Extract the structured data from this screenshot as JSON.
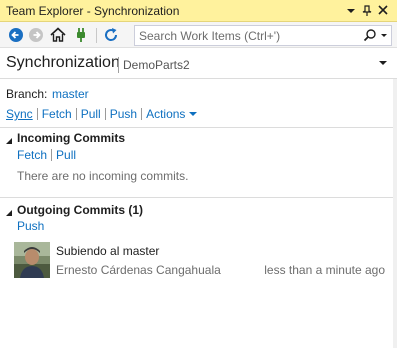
{
  "window": {
    "title": "Team Explorer - Synchronization",
    "title_bg": "#fff29d"
  },
  "toolbar": {
    "search_placeholder": "Search Work Items (Ctrl+')",
    "icons": [
      "back-icon",
      "forward-icon",
      "home-icon",
      "connect-icon",
      "refresh-icon",
      "search-icon",
      "chevron-down-icon"
    ]
  },
  "page": {
    "title": "Synchronization",
    "subtitle": "DemoParts2"
  },
  "branch": {
    "label": "Branch:",
    "name": "master"
  },
  "actions": {
    "sync": "Sync",
    "fetch": "Fetch",
    "pull": "Pull",
    "push": "Push",
    "actions": "Actions"
  },
  "incoming": {
    "title": "Incoming Commits",
    "fetch": "Fetch",
    "pull": "Pull",
    "empty_message": "There are no incoming commits."
  },
  "outgoing": {
    "title": "Outgoing Commits (1)",
    "push": "Push",
    "commits": [
      {
        "message": "Subiendo al master",
        "author": "Ernesto Cárdenas Cangahuala",
        "time": "less than a minute ago"
      }
    ]
  },
  "colors": {
    "link": "#0e70c0",
    "muted": "#6d6d6d"
  }
}
